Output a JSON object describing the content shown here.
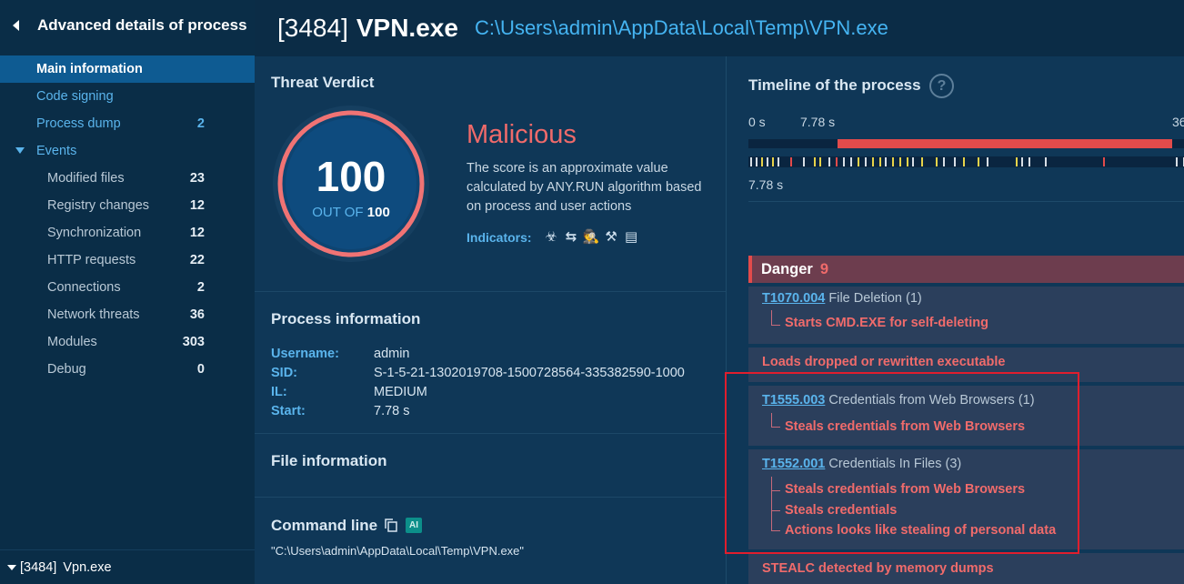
{
  "sidebar": {
    "title": "Advanced details of process",
    "items": [
      {
        "label": "Main information",
        "count": ""
      },
      {
        "label": "Code signing",
        "count": ""
      },
      {
        "label": "Process dump",
        "count": "2"
      },
      {
        "label": "Events",
        "count": ""
      },
      {
        "label": "Modified files",
        "count": "23"
      },
      {
        "label": "Registry changes",
        "count": "12"
      },
      {
        "label": "Synchronization",
        "count": "12"
      },
      {
        "label": "HTTP requests",
        "count": "22"
      },
      {
        "label": "Connections",
        "count": "2"
      },
      {
        "label": "Network threats",
        "count": "36"
      },
      {
        "label": "Modules",
        "count": "303"
      },
      {
        "label": "Debug",
        "count": "0"
      }
    ],
    "footer": {
      "pid": "[3484]",
      "name": "Vpn.exe"
    }
  },
  "header": {
    "pid": "[3484]",
    "process_name": "VPN.exe",
    "path": "C:\\Users\\admin\\AppData\\Local\\Temp\\VPN.exe"
  },
  "verdict": {
    "title": "Threat Verdict",
    "score": "100",
    "out_of_label": "OUT OF",
    "out_of_value": "100",
    "verdict": "Malicious",
    "description": "The score is an approximate value calculated by ANY.RUN algorithm based on process and user actions",
    "indicators_label": "Indicators:",
    "indicator_icons": [
      "biohazard-icon",
      "exchange-icon",
      "spy-icon",
      "tools-icon",
      "document-icon"
    ]
  },
  "process_info": {
    "title": "Process information",
    "rows": [
      {
        "key": "Username:",
        "value": "admin"
      },
      {
        "key": "SID:",
        "value": "S-1-5-21-1302019708-1500728564-335382590-1000"
      },
      {
        "key": "IL:",
        "value": "MEDIUM"
      },
      {
        "key": "Start:",
        "value": "7.78 s"
      }
    ]
  },
  "file_info": {
    "title": "File information"
  },
  "command_line": {
    "title": "Command line",
    "ai_label": "AI",
    "value": "\"C:\\Users\\admin\\AppData\\Local\\Temp\\VPN.exe\""
  },
  "timeline": {
    "title": "Timeline of the process",
    "start_label": "0 s",
    "marker_label": "7.78 s",
    "end_label": "36",
    "bottom_label": "7.78 s",
    "colors": {
      "bar": "#e24b4b",
      "tick_yellow": "#e7d34a",
      "tick_red": "#e24b4b",
      "tick_white": "#d8dfe6"
    }
  },
  "danger": {
    "label": "Danger",
    "count": "9",
    "blocks": [
      {
        "tech_id": "T1070.004",
        "tech_name": "File Deletion (1)",
        "items": [
          "Starts CMD.EXE for self-deleting"
        ]
      },
      {
        "tech_id": "",
        "tech_name": "",
        "items": [
          "Loads dropped or rewritten executable"
        ]
      },
      {
        "tech_id": "T1555.003",
        "tech_name": "Credentials from Web Browsers (1)",
        "items": [
          "Steals credentials from Web Browsers"
        ]
      },
      {
        "tech_id": "T1552.001",
        "tech_name": "Credentials In Files (3)",
        "items": [
          "Steals credentials from Web Browsers",
          "Steals credentials",
          "Actions looks like stealing of personal data"
        ]
      },
      {
        "tech_id": "",
        "tech_name": "",
        "items": [
          "STEALC detected by memory dumps"
        ]
      }
    ]
  }
}
